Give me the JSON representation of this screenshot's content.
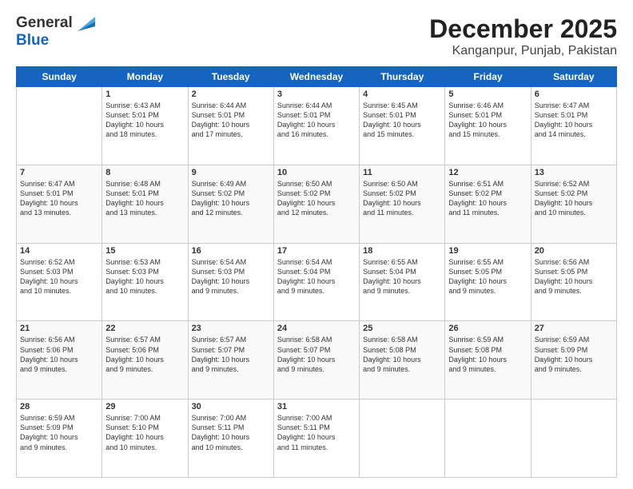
{
  "header": {
    "logo_general": "General",
    "logo_blue": "Blue",
    "title": "December 2025",
    "subtitle": "Kanganpur, Punjab, Pakistan"
  },
  "weekdays": [
    "Sunday",
    "Monday",
    "Tuesday",
    "Wednesday",
    "Thursday",
    "Friday",
    "Saturday"
  ],
  "weeks": [
    [
      {
        "day": "",
        "info": ""
      },
      {
        "day": "1",
        "info": "Sunrise: 6:43 AM\nSunset: 5:01 PM\nDaylight: 10 hours\nand 18 minutes."
      },
      {
        "day": "2",
        "info": "Sunrise: 6:44 AM\nSunset: 5:01 PM\nDaylight: 10 hours\nand 17 minutes."
      },
      {
        "day": "3",
        "info": "Sunrise: 6:44 AM\nSunset: 5:01 PM\nDaylight: 10 hours\nand 16 minutes."
      },
      {
        "day": "4",
        "info": "Sunrise: 6:45 AM\nSunset: 5:01 PM\nDaylight: 10 hours\nand 15 minutes."
      },
      {
        "day": "5",
        "info": "Sunrise: 6:46 AM\nSunset: 5:01 PM\nDaylight: 10 hours\nand 15 minutes."
      },
      {
        "day": "6",
        "info": "Sunrise: 6:47 AM\nSunset: 5:01 PM\nDaylight: 10 hours\nand 14 minutes."
      }
    ],
    [
      {
        "day": "7",
        "info": "Sunrise: 6:47 AM\nSunset: 5:01 PM\nDaylight: 10 hours\nand 13 minutes."
      },
      {
        "day": "8",
        "info": "Sunrise: 6:48 AM\nSunset: 5:01 PM\nDaylight: 10 hours\nand 13 minutes."
      },
      {
        "day": "9",
        "info": "Sunrise: 6:49 AM\nSunset: 5:02 PM\nDaylight: 10 hours\nand 12 minutes."
      },
      {
        "day": "10",
        "info": "Sunrise: 6:50 AM\nSunset: 5:02 PM\nDaylight: 10 hours\nand 12 minutes."
      },
      {
        "day": "11",
        "info": "Sunrise: 6:50 AM\nSunset: 5:02 PM\nDaylight: 10 hours\nand 11 minutes."
      },
      {
        "day": "12",
        "info": "Sunrise: 6:51 AM\nSunset: 5:02 PM\nDaylight: 10 hours\nand 11 minutes."
      },
      {
        "day": "13",
        "info": "Sunrise: 6:52 AM\nSunset: 5:02 PM\nDaylight: 10 hours\nand 10 minutes."
      }
    ],
    [
      {
        "day": "14",
        "info": "Sunrise: 6:52 AM\nSunset: 5:03 PM\nDaylight: 10 hours\nand 10 minutes."
      },
      {
        "day": "15",
        "info": "Sunrise: 6:53 AM\nSunset: 5:03 PM\nDaylight: 10 hours\nand 10 minutes."
      },
      {
        "day": "16",
        "info": "Sunrise: 6:54 AM\nSunset: 5:03 PM\nDaylight: 10 hours\nand 9 minutes."
      },
      {
        "day": "17",
        "info": "Sunrise: 6:54 AM\nSunset: 5:04 PM\nDaylight: 10 hours\nand 9 minutes."
      },
      {
        "day": "18",
        "info": "Sunrise: 6:55 AM\nSunset: 5:04 PM\nDaylight: 10 hours\nand 9 minutes."
      },
      {
        "day": "19",
        "info": "Sunrise: 6:55 AM\nSunset: 5:05 PM\nDaylight: 10 hours\nand 9 minutes."
      },
      {
        "day": "20",
        "info": "Sunrise: 6:56 AM\nSunset: 5:05 PM\nDaylight: 10 hours\nand 9 minutes."
      }
    ],
    [
      {
        "day": "21",
        "info": "Sunrise: 6:56 AM\nSunset: 5:06 PM\nDaylight: 10 hours\nand 9 minutes."
      },
      {
        "day": "22",
        "info": "Sunrise: 6:57 AM\nSunset: 5:06 PM\nDaylight: 10 hours\nand 9 minutes."
      },
      {
        "day": "23",
        "info": "Sunrise: 6:57 AM\nSunset: 5:07 PM\nDaylight: 10 hours\nand 9 minutes."
      },
      {
        "day": "24",
        "info": "Sunrise: 6:58 AM\nSunset: 5:07 PM\nDaylight: 10 hours\nand 9 minutes."
      },
      {
        "day": "25",
        "info": "Sunrise: 6:58 AM\nSunset: 5:08 PM\nDaylight: 10 hours\nand 9 minutes."
      },
      {
        "day": "26",
        "info": "Sunrise: 6:59 AM\nSunset: 5:08 PM\nDaylight: 10 hours\nand 9 minutes."
      },
      {
        "day": "27",
        "info": "Sunrise: 6:59 AM\nSunset: 5:09 PM\nDaylight: 10 hours\nand 9 minutes."
      }
    ],
    [
      {
        "day": "28",
        "info": "Sunrise: 6:59 AM\nSunset: 5:09 PM\nDaylight: 10 hours\nand 9 minutes."
      },
      {
        "day": "29",
        "info": "Sunrise: 7:00 AM\nSunset: 5:10 PM\nDaylight: 10 hours\nand 10 minutes."
      },
      {
        "day": "30",
        "info": "Sunrise: 7:00 AM\nSunset: 5:11 PM\nDaylight: 10 hours\nand 10 minutes."
      },
      {
        "day": "31",
        "info": "Sunrise: 7:00 AM\nSunset: 5:11 PM\nDaylight: 10 hours\nand 11 minutes."
      },
      {
        "day": "",
        "info": ""
      },
      {
        "day": "",
        "info": ""
      },
      {
        "day": "",
        "info": ""
      }
    ]
  ]
}
